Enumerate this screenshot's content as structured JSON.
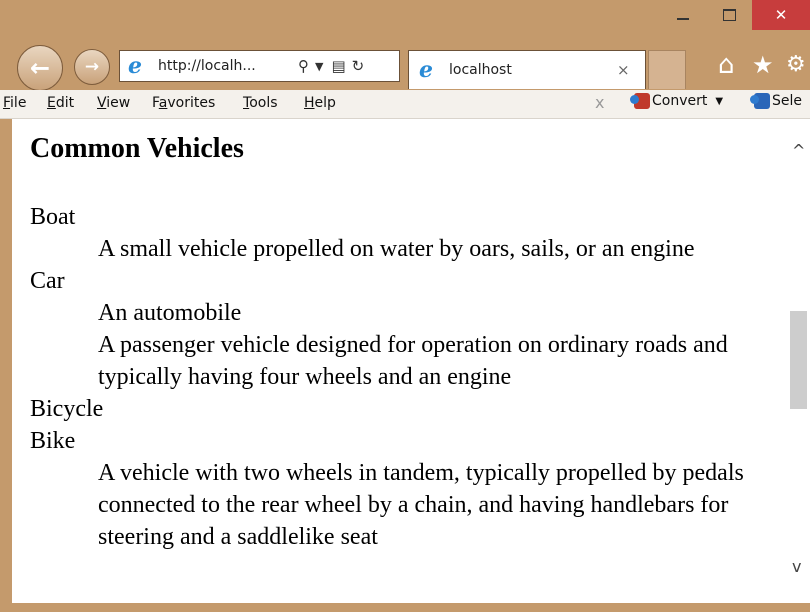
{
  "window": {
    "minimize_icon": "minimize-icon",
    "maximize_icon": "maximize-icon",
    "close_glyph": "✕"
  },
  "navigation": {
    "back_glyph": "←",
    "forward_glyph": "→",
    "address": "http://localh...",
    "address_icons": [
      "search-icon",
      "dropdown-icon",
      "compat-view-icon",
      "refresh-icon"
    ]
  },
  "tab": {
    "title": "localhost",
    "close_glyph": "×"
  },
  "toolbar_icons": [
    "home-icon",
    "favorites-star-icon",
    "settings-gear-icon"
  ],
  "menu": {
    "items": [
      {
        "accel": "F",
        "rest": "ile"
      },
      {
        "accel": "E",
        "rest": "dit"
      },
      {
        "accel": "V",
        "rest": "iew"
      },
      {
        "pre": "F",
        "accel": "a",
        "rest": "vorites"
      },
      {
        "accel": "T",
        "rest": "ools"
      },
      {
        "accel": "H",
        "rest": "elp"
      }
    ],
    "close_glyph": "x",
    "convert_label": "Convert",
    "select_label": "Sele"
  },
  "content": {
    "title": "Common Vehicles",
    "definitions": {
      "boat_term": "Boat",
      "boat_def": "A small vehicle propelled on water by oars, sails, or an engine",
      "car_term": "Car",
      "car_def_1": "An automobile",
      "car_def_2": "A passenger vehicle designed for operation on ordinary roads and typically having four wheels and an engine",
      "bicycle_term": "Bicycle",
      "bike_term": "Bike",
      "bike_def": "A vehicle with two wheels in tandem, typically propelled by pedals connected to the rear wheel by a chain, and having handlebars for steering and a saddlelike seat"
    }
  },
  "colors": {
    "frame": "#c49a6c",
    "close_button": "#c73d3d",
    "ie_blue": "#2a8bd6"
  }
}
